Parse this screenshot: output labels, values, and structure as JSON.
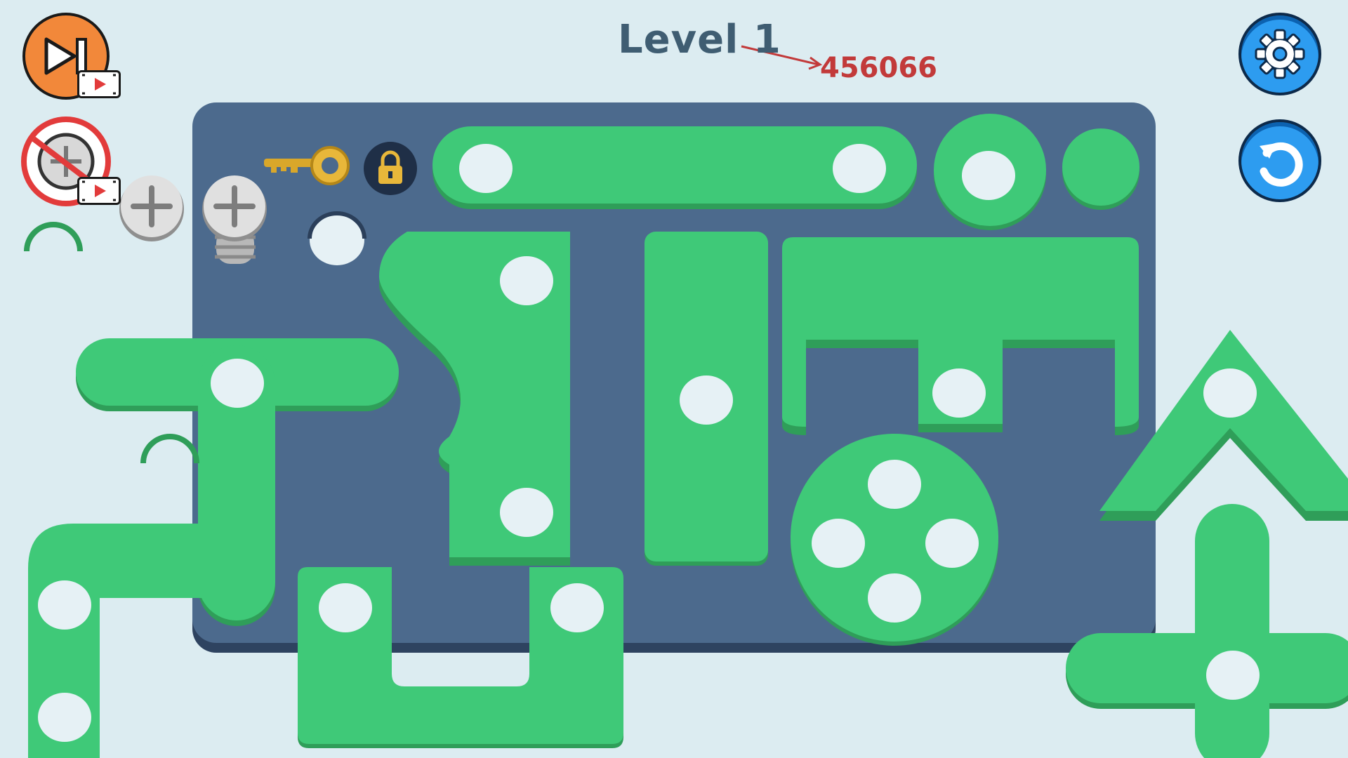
{
  "level": {
    "label": "Level 1"
  },
  "annotation": {
    "text": "456066",
    "color": "#c23a3a"
  },
  "buttons": {
    "skip_level": {
      "icon": "skip-forward-icon",
      "badge": "video-ad-icon"
    },
    "remove_screw": {
      "icon": "no-screw-icon",
      "badge": "video-ad-icon"
    },
    "settings": {
      "icon": "gear-icon"
    },
    "restart": {
      "icon": "restart-icon"
    }
  },
  "inventory": {
    "screws": 2,
    "key": "key-icon",
    "lock": "lock-icon"
  },
  "colors": {
    "background": "#dcecf1",
    "board": "#4c6a8d",
    "plank": "#3fc978",
    "plank_shadow": "#2f9e59",
    "hole": "#e6f1f5",
    "button_blue": "#2d9cf0",
    "button_orange": "#f2883a"
  }
}
